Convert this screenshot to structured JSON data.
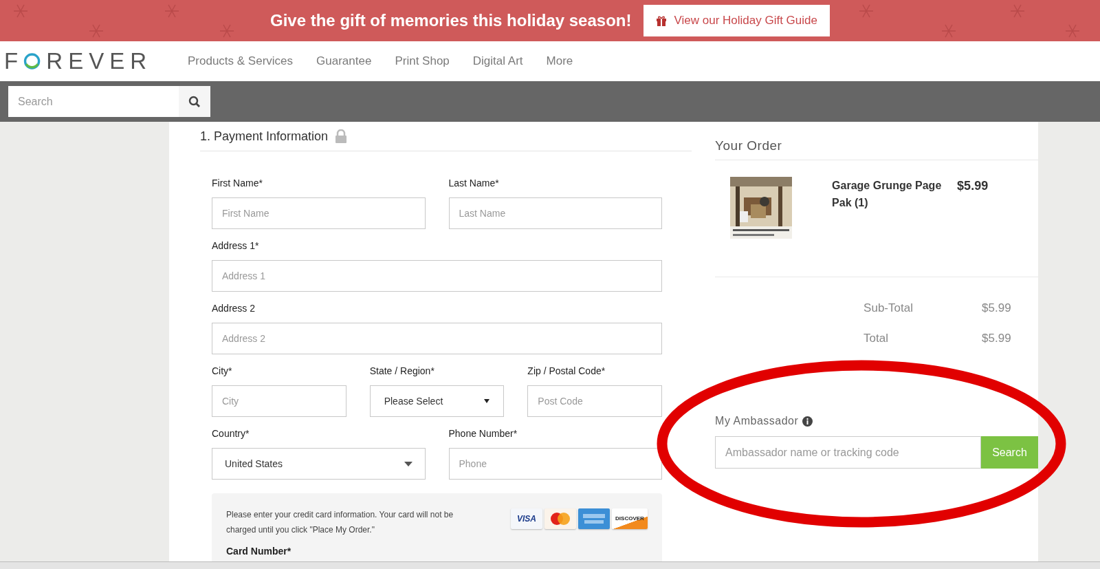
{
  "banner": {
    "headline": "Give the gift of memories this holiday season!",
    "button": "View our Holiday Gift Guide"
  },
  "logo": {
    "before": "F",
    "after": "REVER"
  },
  "nav": {
    "items": [
      "Products & Services",
      "Guarantee",
      "Print Shop",
      "Digital Art",
      "More"
    ]
  },
  "search": {
    "placeholder": "Search"
  },
  "payment": {
    "heading": "1. Payment Information",
    "rows": [
      [
        {
          "label": "First Name*",
          "placeholder": "First Name",
          "kind": "text"
        },
        {
          "label": "Last Name*",
          "placeholder": "Last Name",
          "kind": "text"
        }
      ],
      [
        {
          "label": "Address 1*",
          "placeholder": "Address 1",
          "kind": "text"
        }
      ],
      [
        {
          "label": "Address 2",
          "placeholder": "Address 2",
          "kind": "text"
        }
      ],
      [
        {
          "label": "City*",
          "placeholder": "City",
          "kind": "text"
        },
        {
          "label": "State / Region*",
          "value": "Please Select",
          "kind": "select"
        },
        {
          "label": "Zip / Postal Code*",
          "placeholder": "Post Code",
          "kind": "text"
        }
      ],
      [
        {
          "label": "Country*",
          "value": "United States",
          "kind": "dropdown"
        },
        {
          "label": "Phone Number*",
          "placeholder": "Phone",
          "kind": "text"
        }
      ]
    ],
    "card_note": "Please enter your credit card information. Your card will not be charged until you click \"Place My Order.\"",
    "cards": [
      {
        "kind": "visa",
        "label": "VISA"
      },
      {
        "kind": "mastercard"
      },
      {
        "kind": "amex"
      },
      {
        "kind": "discover",
        "label": "DISCOVER"
      }
    ],
    "card_number_label": "Card Number*"
  },
  "order": {
    "heading": "Your Order",
    "items": [
      {
        "name": "Garage Grunge Page Pak (1)",
        "price": "$5.99"
      }
    ],
    "totals": [
      {
        "label": "Sub-Total",
        "value": "$5.99"
      },
      {
        "label": "Total",
        "value": "$5.99"
      }
    ],
    "ambassador": {
      "label": "My Ambassador",
      "placeholder": "Ambassador name or tracking code",
      "button": "Search"
    }
  }
}
